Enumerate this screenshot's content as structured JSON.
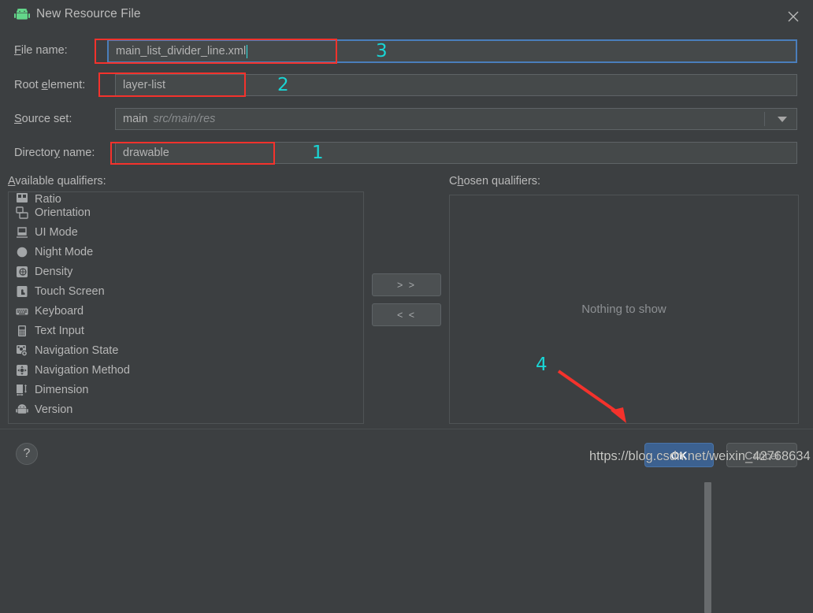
{
  "window": {
    "title": "New Resource File",
    "app_icon": "android-robot-icon",
    "close_icon": "close-icon",
    "accent_blue": "#3c6190",
    "background": "#3c3f41",
    "annotation_red": "#f4322c",
    "annotation_cyan": "#19d5d5"
  },
  "form": {
    "file_name": {
      "label_pre": "F",
      "label_mnemonic": "",
      "label": "File name:",
      "value": "main_list_divider_line.xml",
      "focused": true
    },
    "root_element": {
      "label": "Root element:",
      "value": "layer-list"
    },
    "source_set": {
      "label": "Source set:",
      "value": "main",
      "value_path": "src/main/res",
      "dropdown_icon": "chevron-down-icon"
    },
    "directory_name": {
      "label": "Directory name:",
      "value": "drawable"
    }
  },
  "qualifiers": {
    "available_label": "Available qualifiers:",
    "chosen_label": "Chosen qualifiers:",
    "empty_text": "Nothing to show",
    "add_label": "> >",
    "remove_label": "< <",
    "available_items": [
      {
        "label": "Ratio",
        "icon": "ratio-icon",
        "clipped": true
      },
      {
        "label": "Orientation",
        "icon": "orientation-icon"
      },
      {
        "label": "UI Mode",
        "icon": "ui-mode-icon"
      },
      {
        "label": "Night Mode",
        "icon": "night-mode-icon"
      },
      {
        "label": "Density",
        "icon": "density-icon"
      },
      {
        "label": "Touch Screen",
        "icon": "touch-screen-icon"
      },
      {
        "label": "Keyboard",
        "icon": "keyboard-icon"
      },
      {
        "label": "Text Input",
        "icon": "text-input-icon"
      },
      {
        "label": "Navigation State",
        "icon": "navigation-state-icon"
      },
      {
        "label": "Navigation Method",
        "icon": "navigation-method-icon"
      },
      {
        "label": "Dimension",
        "icon": "dimension-icon"
      },
      {
        "label": "Version",
        "icon": "version-android-icon"
      }
    ],
    "chosen_items": []
  },
  "footer": {
    "help_label": "?",
    "ok_label": "OK",
    "cancel_label": "Cancel"
  },
  "annotations": {
    "numbers": [
      {
        "text": "1",
        "target": "directory-name-field"
      },
      {
        "text": "2",
        "target": "root-element-field"
      },
      {
        "text": "3",
        "target": "file-name-field"
      },
      {
        "text": "4",
        "target": "ok-button"
      }
    ],
    "arrow": {
      "from": "4",
      "to": "ok-button",
      "color": "#f4322c"
    }
  },
  "watermark": {
    "text": "https://blog.csdn.net/weixin_42768634"
  }
}
